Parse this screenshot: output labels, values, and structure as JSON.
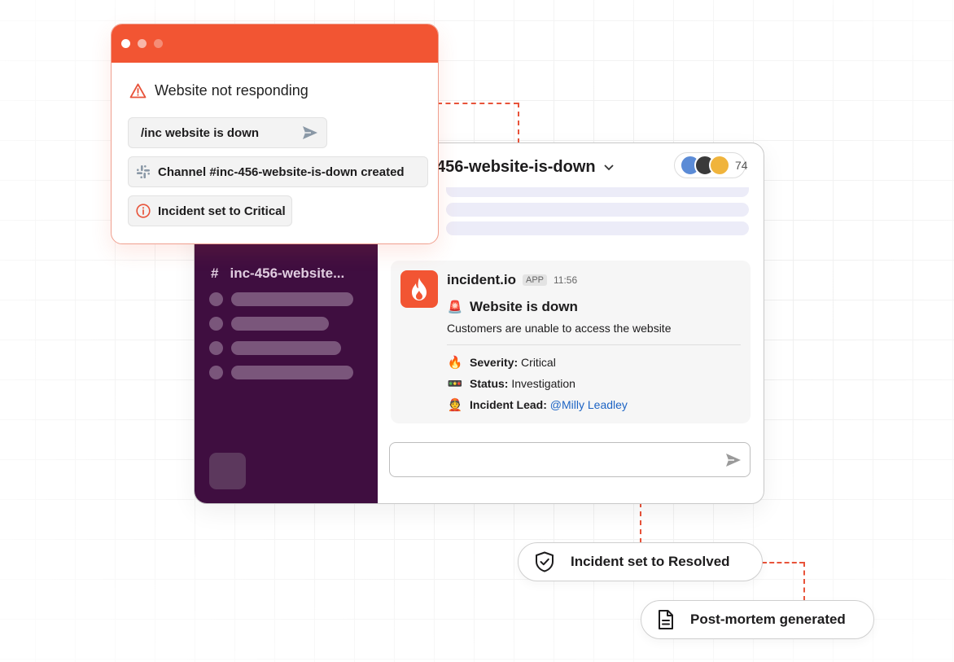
{
  "alert": {
    "title": "Website not responding",
    "command": "/inc website is down",
    "channel_created": "Channel #inc-456-website-is-down created",
    "severity_set": "Incident set to Critical",
    "colors": {
      "titlebar": "#f25533",
      "dots": [
        "#ffffff",
        "#f8b7a9",
        "#f58d76"
      ]
    }
  },
  "slack": {
    "sidebar_channel": "inc-456-website...",
    "channel_hash": "#",
    "channel_title": "456-website-is-down",
    "member_count": "74",
    "message": {
      "app_name": "incident.io",
      "app_badge": "APP",
      "time": "11:56",
      "title": "Website is down",
      "description": "Customers are unable to access the website",
      "severity_label": "Severity:",
      "severity_value": "Critical",
      "status_label": "Status:",
      "status_value": "Investigation",
      "lead_label": "Incident Lead:",
      "lead_value": "@Milly Leadley",
      "emoji": {
        "title": "🚨",
        "severity": "🔥",
        "status": "🚥",
        "lead": "👲"
      }
    }
  },
  "badges": {
    "resolved": "Incident set to Resolved",
    "postmortem": "Post-mortem generated"
  },
  "icons": [
    "warning-icon",
    "send-icon",
    "slack-icon",
    "info-icon",
    "flame-icon",
    "chevron-down-icon",
    "shield-check-icon",
    "document-icon"
  ]
}
